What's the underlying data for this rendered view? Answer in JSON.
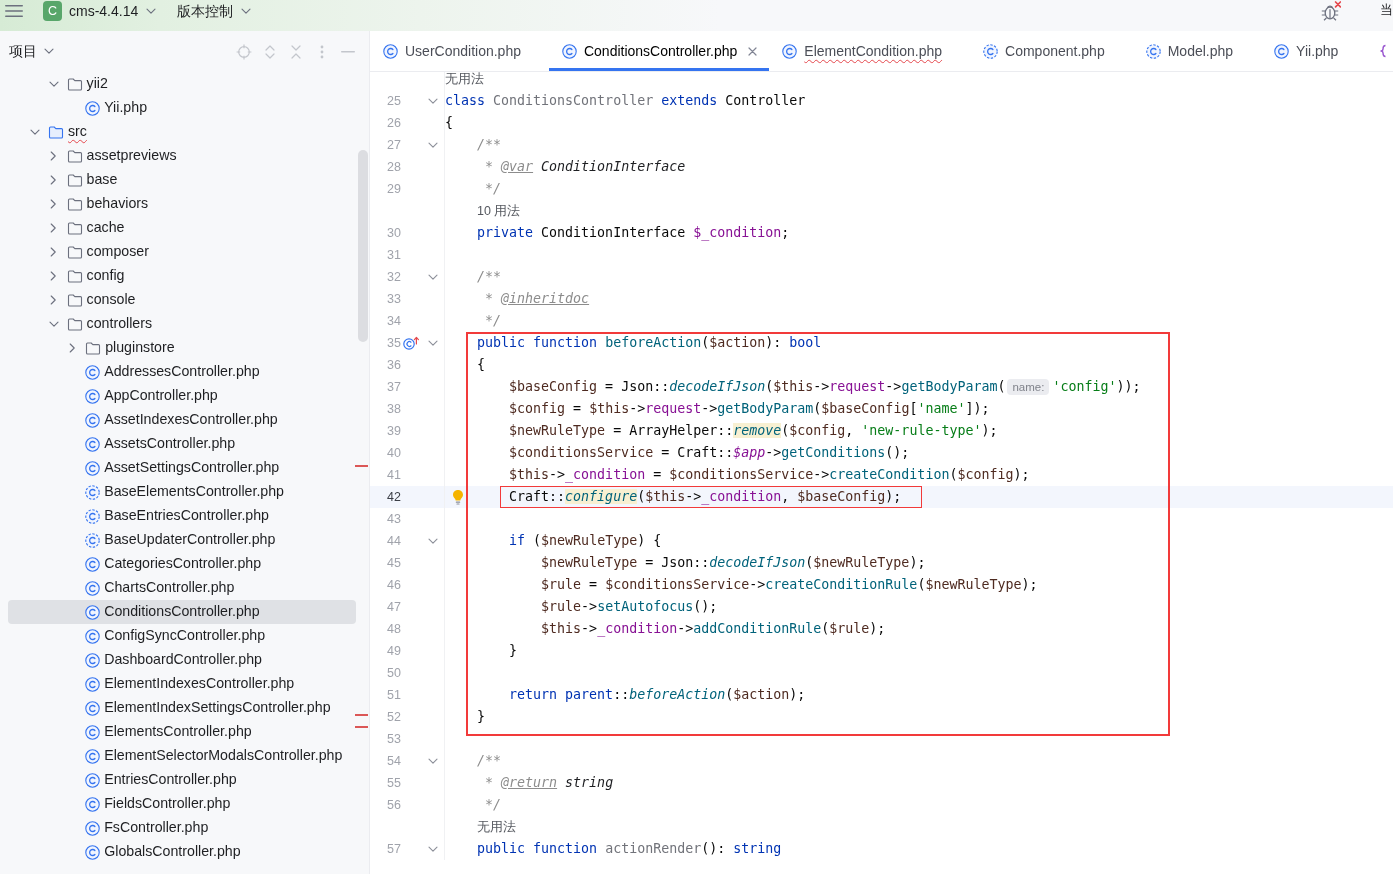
{
  "title_bar": {
    "project_initial": "C",
    "project": "cms-4.4.14",
    "vcs_menu": "版本控制",
    "trailing_label": "当"
  },
  "project_panel": {
    "title": "项目",
    "tree": [
      {
        "children": [
          {
            "label": "yii2",
            "kind": "folder",
            "expanded": true,
            "selected": false,
            "error": false,
            "children": [
              {
                "label": "Yii.php",
                "kind": "class",
                "selected": false,
                "error": false
              }
            ]
          }
        ]
      },
      {
        "label": "src",
        "kind": "source_folder",
        "expanded": true,
        "selected": false,
        "error": true,
        "children": [
          {
            "label": "assetpreviews",
            "kind": "folder",
            "expanded": false,
            "selected": false,
            "error": false
          },
          {
            "label": "base",
            "kind": "folder",
            "expanded": false,
            "selected": false,
            "error": false
          },
          {
            "label": "behaviors",
            "kind": "folder",
            "expanded": false,
            "selected": false,
            "error": false
          },
          {
            "label": "cache",
            "kind": "folder",
            "expanded": false,
            "selected": false,
            "error": false
          },
          {
            "label": "composer",
            "kind": "folder",
            "expanded": false,
            "selected": false,
            "error": false
          },
          {
            "label": "config",
            "kind": "folder",
            "expanded": false,
            "selected": false,
            "error": false
          },
          {
            "label": "console",
            "kind": "folder",
            "expanded": false,
            "selected": false,
            "error": false
          },
          {
            "label": "controllers",
            "kind": "folder",
            "expanded": true,
            "selected": false,
            "error": false,
            "children": [
              {
                "label": "pluginstore",
                "kind": "folder",
                "expanded": false,
                "selected": false,
                "error": false
              },
              {
                "label": "AddressesController.php",
                "kind": "class",
                "selected": false,
                "error": false
              },
              {
                "label": "AppController.php",
                "kind": "class",
                "selected": false,
                "error": false
              },
              {
                "label": "AssetIndexesController.php",
                "kind": "class",
                "selected": false,
                "error": false
              },
              {
                "label": "AssetsController.php",
                "kind": "class",
                "selected": false,
                "error": false
              },
              {
                "label": "AssetSettingsController.php",
                "kind": "class",
                "selected": false,
                "error": false
              },
              {
                "label": "BaseElementsController.php",
                "kind": "abstract",
                "selected": false,
                "error": false
              },
              {
                "label": "BaseEntriesController.php",
                "kind": "abstract",
                "selected": false,
                "error": false
              },
              {
                "label": "BaseUpdaterController.php",
                "kind": "abstract",
                "selected": false,
                "error": false
              },
              {
                "label": "CategoriesController.php",
                "kind": "class",
                "selected": false,
                "error": false
              },
              {
                "label": "ChartsController.php",
                "kind": "class",
                "selected": false,
                "error": false
              },
              {
                "label": "ConditionsController.php",
                "kind": "class",
                "selected": true,
                "error": false
              },
              {
                "label": "ConfigSyncController.php",
                "kind": "class",
                "selected": false,
                "error": false
              },
              {
                "label": "DashboardController.php",
                "kind": "class",
                "selected": false,
                "error": false
              },
              {
                "label": "ElementIndexesController.php",
                "kind": "class",
                "selected": false,
                "error": false
              },
              {
                "label": "ElementIndexSettingsController.php",
                "kind": "class",
                "selected": false,
                "error": false
              },
              {
                "label": "ElementsController.php",
                "kind": "class",
                "selected": false,
                "error": false
              },
              {
                "label": "ElementSelectorModalsController.php",
                "kind": "class",
                "selected": false,
                "error": false
              },
              {
                "label": "EntriesController.php",
                "kind": "class",
                "selected": false,
                "error": false
              },
              {
                "label": "FieldsController.php",
                "kind": "class",
                "selected": false,
                "error": false
              },
              {
                "label": "FsController.php",
                "kind": "class",
                "selected": false,
                "error": false
              },
              {
                "label": "GlobalsController.php",
                "kind": "class",
                "selected": false,
                "error": false
              }
            ]
          }
        ]
      }
    ]
  },
  "tabs": [
    {
      "label": "UserCondition.php",
      "kind": "class",
      "selected": false,
      "error": false
    },
    {
      "label": "ConditionsController.php",
      "kind": "class",
      "selected": true,
      "error": false
    },
    {
      "label": "ElementCondition.php",
      "kind": "class",
      "selected": false,
      "error": true
    },
    {
      "label": "Component.php",
      "kind": "abstract",
      "selected": false,
      "error": false
    },
    {
      "label": "Model.php",
      "kind": "abstract",
      "selected": false,
      "error": false
    },
    {
      "label": "Yii.php",
      "kind": "class",
      "selected": false,
      "error": false
    },
    {
      "kind": "braces",
      "selected": false
    }
  ],
  "editor": {
    "rows": [
      {
        "kind": "hint",
        "text": "无用法"
      },
      {
        "kind": "line",
        "number": "25",
        "fold": true,
        "current": false,
        "framed": false,
        "code": [
          {
            "kind": "kw",
            "text": "class "
          },
          {
            "kind": "unused",
            "text": "ConditionsController "
          },
          {
            "kind": "kw",
            "text": "extends "
          },
          {
            "kind": "plain",
            "text": "Controller"
          }
        ]
      },
      {
        "kind": "line",
        "number": "26",
        "fold": false,
        "current": false,
        "framed": false,
        "code": [
          {
            "kind": "plain",
            "text": "{"
          }
        ]
      },
      {
        "kind": "line",
        "number": "27",
        "fold": true,
        "current": false,
        "framed": false,
        "code": [
          {
            "kind": "doc",
            "text": "    /**"
          }
        ]
      },
      {
        "kind": "line",
        "number": "28",
        "fold": false,
        "current": false,
        "framed": false,
        "code": [
          {
            "kind": "doc",
            "text": "     * "
          },
          {
            "kind": "tag",
            "text": "@var"
          },
          {
            "kind": "doctype",
            "text": " ConditionInterface"
          }
        ]
      },
      {
        "kind": "line",
        "number": "29",
        "fold": false,
        "current": false,
        "framed": false,
        "code": [
          {
            "kind": "doc",
            "text": "     */"
          }
        ]
      },
      {
        "kind": "hint",
        "text": "10 用法"
      },
      {
        "kind": "line",
        "number": "30",
        "fold": false,
        "current": false,
        "framed": false,
        "code": [
          {
            "kind": "kw",
            "text": "    private "
          },
          {
            "kind": "plain",
            "text": "ConditionInterface "
          },
          {
            "kind": "field",
            "text": "$_condition"
          },
          {
            "kind": "plain",
            "text": ";"
          }
        ]
      },
      {
        "kind": "line",
        "number": "31",
        "fold": false,
        "current": false,
        "framed": false
      },
      {
        "kind": "line",
        "number": "32",
        "fold": true,
        "current": false,
        "framed": false,
        "code": [
          {
            "kind": "doc",
            "text": "    /**"
          }
        ]
      },
      {
        "kind": "line",
        "number": "33",
        "fold": false,
        "current": false,
        "framed": false,
        "code": [
          {
            "kind": "doc",
            "text": "     * "
          },
          {
            "kind": "tag",
            "text": "@inheritdoc"
          }
        ]
      },
      {
        "kind": "line",
        "number": "34",
        "fold": false,
        "current": false,
        "framed": false,
        "code": [
          {
            "kind": "doc",
            "text": "     */"
          }
        ]
      },
      {
        "kind": "frame",
        "rows": [
          {
            "kind": "line",
            "number": "35",
            "fold": true,
            "current": false,
            "framed": false,
            "gutter": {
              "kind": "override"
            },
            "code": [
              {
                "kind": "kw",
                "text": "    public function "
              },
              {
                "kind": "decl",
                "text": "beforeAction"
              },
              {
                "kind": "plain",
                "text": "("
              },
              {
                "kind": "var",
                "text": "$action"
              },
              {
                "kind": "plain",
                "text": "): "
              },
              {
                "kind": "kw",
                "text": "bool"
              }
            ]
          },
          {
            "kind": "line",
            "number": "36",
            "fold": false,
            "current": false,
            "framed": false,
            "code": [
              {
                "kind": "plain",
                "text": "    {"
              }
            ]
          },
          {
            "kind": "line",
            "number": "37",
            "fold": false,
            "current": false,
            "framed": false,
            "code": [
              {
                "kind": "var",
                "text": "        $baseConfig"
              },
              {
                "kind": "plain",
                "text": " = Json::"
              },
              {
                "kind": "scall",
                "text": "decodeIfJson"
              },
              {
                "kind": "plain",
                "text": "("
              },
              {
                "kind": "var",
                "text": "$this"
              },
              {
                "kind": "plain",
                "text": "->"
              },
              {
                "kind": "field",
                "text": "request"
              },
              {
                "kind": "plain",
                "text": "->"
              },
              {
                "kind": "call",
                "text": "getBodyParam"
              },
              {
                "kind": "plain",
                "text": "("
              },
              {
                "kind": "hint",
                "text": "name:"
              },
              {
                "kind": "str",
                "text": "'config'"
              },
              {
                "kind": "plain",
                "text": "));"
              }
            ]
          },
          {
            "kind": "line",
            "number": "38",
            "fold": false,
            "current": false,
            "framed": false,
            "code": [
              {
                "kind": "var",
                "text": "        $config"
              },
              {
                "kind": "plain",
                "text": " = "
              },
              {
                "kind": "var",
                "text": "$this"
              },
              {
                "kind": "plain",
                "text": "->"
              },
              {
                "kind": "field",
                "text": "request"
              },
              {
                "kind": "plain",
                "text": "->"
              },
              {
                "kind": "call",
                "text": "getBodyParam"
              },
              {
                "kind": "plain",
                "text": "("
              },
              {
                "kind": "var",
                "text": "$baseConfig"
              },
              {
                "kind": "plain",
                "text": "["
              },
              {
                "kind": "str",
                "text": "'name'"
              },
              {
                "kind": "plain",
                "text": "]);"
              }
            ]
          },
          {
            "kind": "line",
            "number": "39",
            "fold": false,
            "current": false,
            "framed": false,
            "code": [
              {
                "kind": "var",
                "text": "        $newRuleType"
              },
              {
                "kind": "plain",
                "text": " = ArrayHelper::"
              },
              {
                "kind": "flag",
                "text": "remove"
              },
              {
                "kind": "plain",
                "text": "("
              },
              {
                "kind": "var",
                "text": "$config"
              },
              {
                "kind": "plain",
                "text": ", "
              },
              {
                "kind": "str",
                "text": "'new-rule-type'"
              },
              {
                "kind": "plain",
                "text": ");"
              }
            ]
          },
          {
            "kind": "line",
            "number": "40",
            "fold": false,
            "current": false,
            "framed": false,
            "code": [
              {
                "kind": "var",
                "text": "        $conditionsService"
              },
              {
                "kind": "plain",
                "text": " = Craft::"
              },
              {
                "kind": "sfield",
                "text": "$app"
              },
              {
                "kind": "plain",
                "text": "->"
              },
              {
                "kind": "call",
                "text": "getConditions"
              },
              {
                "kind": "plain",
                "text": "();"
              }
            ]
          },
          {
            "kind": "line",
            "number": "41",
            "fold": false,
            "current": false,
            "framed": false,
            "code": [
              {
                "kind": "var",
                "text": "        $this"
              },
              {
                "kind": "plain",
                "text": "->"
              },
              {
                "kind": "field",
                "text": "_condition"
              },
              {
                "kind": "plain",
                "text": " = "
              },
              {
                "kind": "var",
                "text": "$conditionsService"
              },
              {
                "kind": "plain",
                "text": "->"
              },
              {
                "kind": "call",
                "text": "createCondition"
              },
              {
                "kind": "plain",
                "text": "("
              },
              {
                "kind": "var",
                "text": "$config"
              },
              {
                "kind": "plain",
                "text": ");"
              }
            ]
          },
          {
            "kind": "line",
            "number": "42",
            "fold": false,
            "current": true,
            "framed": true,
            "gutter": {
              "kind": "bulb"
            },
            "code": [
              {
                "kind": "plain",
                "text": "        Craft::"
              },
              {
                "kind": "flag",
                "text": "configure"
              },
              {
                "kind": "plain",
                "text": "("
              },
              {
                "kind": "var",
                "text": "$this"
              },
              {
                "kind": "plain",
                "text": "->"
              },
              {
                "kind": "field",
                "text": "_condition"
              },
              {
                "kind": "plain",
                "text": ", "
              },
              {
                "kind": "var",
                "text": "$baseConfig"
              },
              {
                "kind": "plain",
                "text": ");"
              }
            ]
          },
          {
            "kind": "line",
            "number": "43",
            "fold": false,
            "current": false,
            "framed": false
          },
          {
            "kind": "line",
            "number": "44",
            "fold": true,
            "current": false,
            "framed": false,
            "code": [
              {
                "kind": "kw",
                "text": "        if "
              },
              {
                "kind": "plain",
                "text": "("
              },
              {
                "kind": "var",
                "text": "$newRuleType"
              },
              {
                "kind": "plain",
                "text": ") {"
              }
            ]
          },
          {
            "kind": "line",
            "number": "45",
            "fold": false,
            "current": false,
            "framed": false,
            "code": [
              {
                "kind": "var",
                "text": "            $newRuleType"
              },
              {
                "kind": "plain",
                "text": " = Json::"
              },
              {
                "kind": "scall",
                "text": "decodeIfJson"
              },
              {
                "kind": "plain",
                "text": "("
              },
              {
                "kind": "var",
                "text": "$newRuleType"
              },
              {
                "kind": "plain",
                "text": ");"
              }
            ]
          },
          {
            "kind": "line",
            "number": "46",
            "fold": false,
            "current": false,
            "framed": false,
            "code": [
              {
                "kind": "var",
                "text": "            $rule"
              },
              {
                "kind": "plain",
                "text": " = "
              },
              {
                "kind": "var",
                "text": "$conditionsService"
              },
              {
                "kind": "plain",
                "text": "->"
              },
              {
                "kind": "call",
                "text": "createConditionRule"
              },
              {
                "kind": "plain",
                "text": "("
              },
              {
                "kind": "var",
                "text": "$newRuleType"
              },
              {
                "kind": "plain",
                "text": ");"
              }
            ]
          },
          {
            "kind": "line",
            "number": "47",
            "fold": false,
            "current": false,
            "framed": false,
            "code": [
              {
                "kind": "var",
                "text": "            $rule"
              },
              {
                "kind": "plain",
                "text": "->"
              },
              {
                "kind": "call",
                "text": "setAutofocus"
              },
              {
                "kind": "plain",
                "text": "();"
              }
            ]
          },
          {
            "kind": "line",
            "number": "48",
            "fold": false,
            "current": false,
            "framed": false,
            "code": [
              {
                "kind": "var",
                "text": "            $this"
              },
              {
                "kind": "plain",
                "text": "->"
              },
              {
                "kind": "field",
                "text": "_condition"
              },
              {
                "kind": "plain",
                "text": "->"
              },
              {
                "kind": "call",
                "text": "addConditionRule"
              },
              {
                "kind": "plain",
                "text": "("
              },
              {
                "kind": "var",
                "text": "$rule"
              },
              {
                "kind": "plain",
                "text": ");"
              }
            ]
          },
          {
            "kind": "line",
            "number": "49",
            "fold": false,
            "current": false,
            "framed": false,
            "code": [
              {
                "kind": "plain",
                "text": "        }"
              }
            ]
          },
          {
            "kind": "line",
            "number": "50",
            "fold": false,
            "current": false,
            "framed": false
          },
          {
            "kind": "line",
            "number": "51",
            "fold": false,
            "current": false,
            "framed": false,
            "code": [
              {
                "kind": "kw",
                "text": "        return parent"
              },
              {
                "kind": "plain",
                "text": "::"
              },
              {
                "kind": "scall",
                "text": "beforeAction"
              },
              {
                "kind": "plain",
                "text": "("
              },
              {
                "kind": "var",
                "text": "$action"
              },
              {
                "kind": "plain",
                "text": ");"
              }
            ]
          },
          {
            "kind": "line",
            "number": "52",
            "fold": false,
            "current": false,
            "framed": false,
            "code": [
              {
                "kind": "plain",
                "text": "    }"
              }
            ]
          }
        ]
      },
      {
        "kind": "line",
        "number": "53",
        "fold": false,
        "current": false,
        "framed": false
      },
      {
        "kind": "line",
        "number": "54",
        "fold": true,
        "current": false,
        "framed": false,
        "code": [
          {
            "kind": "doc",
            "text": "    /**"
          }
        ]
      },
      {
        "kind": "line",
        "number": "55",
        "fold": false,
        "current": false,
        "framed": false,
        "code": [
          {
            "kind": "doc",
            "text": "     * "
          },
          {
            "kind": "tag",
            "text": "@return"
          },
          {
            "kind": "doctype",
            "text": " string"
          }
        ]
      },
      {
        "kind": "line",
        "number": "56",
        "fold": false,
        "current": false,
        "framed": false,
        "code": [
          {
            "kind": "doc",
            "text": "     */"
          }
        ]
      },
      {
        "kind": "hint",
        "text": "无用法"
      },
      {
        "kind": "line",
        "number": "57",
        "fold": true,
        "current": false,
        "framed": false,
        "code": [
          {
            "kind": "kw",
            "text": "    public function "
          },
          {
            "kind": "unused",
            "text": "actionRender"
          },
          {
            "kind": "plain",
            "text": "(): "
          },
          {
            "kind": "kw",
            "text": "string"
          }
        ]
      }
    ]
  }
}
